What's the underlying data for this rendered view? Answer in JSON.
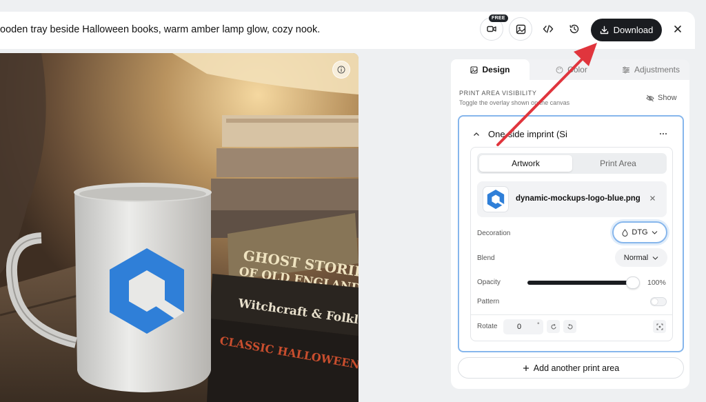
{
  "header": {
    "prompt": "ooden tray beside Halloween books, warm amber lamp glow, cozy nook.",
    "free_badge": "FREE",
    "download_label": "Download",
    "icons": [
      "video-icon",
      "image-icon",
      "code-icon",
      "history-icon",
      "close-icon"
    ]
  },
  "canvas": {
    "books": [
      "GHOST STORIES",
      "OF OLD ENGLAND",
      "Witchcraft & Folklore",
      "CLASSIC HALLOWEEN TALES"
    ]
  },
  "panel": {
    "tabs": [
      {
        "label": "Design",
        "icon": "image-icon"
      },
      {
        "label": "Color",
        "icon": "palette-icon"
      },
      {
        "label": "Adjustments",
        "icon": "sliders-icon"
      }
    ],
    "visibility": {
      "title": "PRINT AREA VISIBILITY",
      "subtitle": "Toggle the overlay shown on the canvas",
      "show_label": "Show"
    },
    "print_area": {
      "title": "One-side imprint (Si",
      "segments": [
        "Artwork",
        "Print Area"
      ],
      "file_name": "dynamic-mockups-logo-blue.png",
      "decoration_label": "Decoration",
      "decoration_value": "DTG",
      "blend_label": "Blend",
      "blend_value": "Normal",
      "opacity_label": "Opacity",
      "opacity_value": "100%",
      "opacity_fraction": 1.0,
      "pattern_label": "Pattern",
      "pattern_enabled": false,
      "rotate_label": "Rotate",
      "rotate_value": "0",
      "rotate_unit": "°"
    },
    "add_label": "Add another print area"
  },
  "colors": {
    "accent_border": "#86b6ec",
    "download_bg": "#1a1c20",
    "arrow": "#e0353d",
    "logo_blue": "#2f7fd8"
  }
}
